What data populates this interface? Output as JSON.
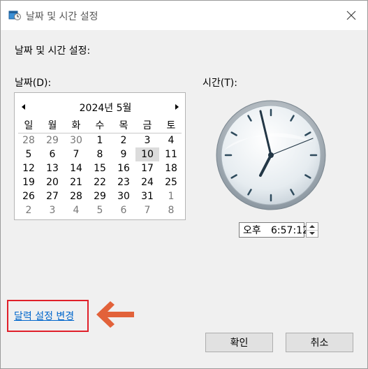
{
  "window": {
    "title": "날짜 및 시간 설정"
  },
  "heading": "날짜 및 시간 설정:",
  "date_label": "날짜(D):",
  "time_label": "시간(T):",
  "calendar": {
    "title": "2024년 5월",
    "weekdays": [
      "일",
      "월",
      "화",
      "수",
      "목",
      "금",
      "토"
    ],
    "weeks": [
      [
        "28",
        "29",
        "30",
        "1",
        "2",
        "3",
        "4"
      ],
      [
        "5",
        "6",
        "7",
        "8",
        "9",
        "10",
        "11"
      ],
      [
        "12",
        "13",
        "14",
        "15",
        "16",
        "17",
        "18"
      ],
      [
        "19",
        "20",
        "21",
        "22",
        "23",
        "24",
        "25"
      ],
      [
        "26",
        "27",
        "28",
        "29",
        "30",
        "31",
        "1"
      ],
      [
        "2",
        "3",
        "4",
        "5",
        "6",
        "7",
        "8"
      ]
    ],
    "selected": "10"
  },
  "time": {
    "ampm": "오후",
    "value": "6:57:12"
  },
  "change_calendar_link": "달력 설정 변경",
  "buttons": {
    "ok": "확인",
    "cancel": "취소"
  },
  "colors": {
    "highlight_box": "#e0202a",
    "arrow": "#e2623a",
    "link": "#0066cc"
  },
  "icons": {
    "app": "calendar-clock-icon",
    "close": "close-icon",
    "prev": "triangle-left-icon",
    "next": "triangle-right-icon",
    "arrow": "arrow-left-icon"
  }
}
